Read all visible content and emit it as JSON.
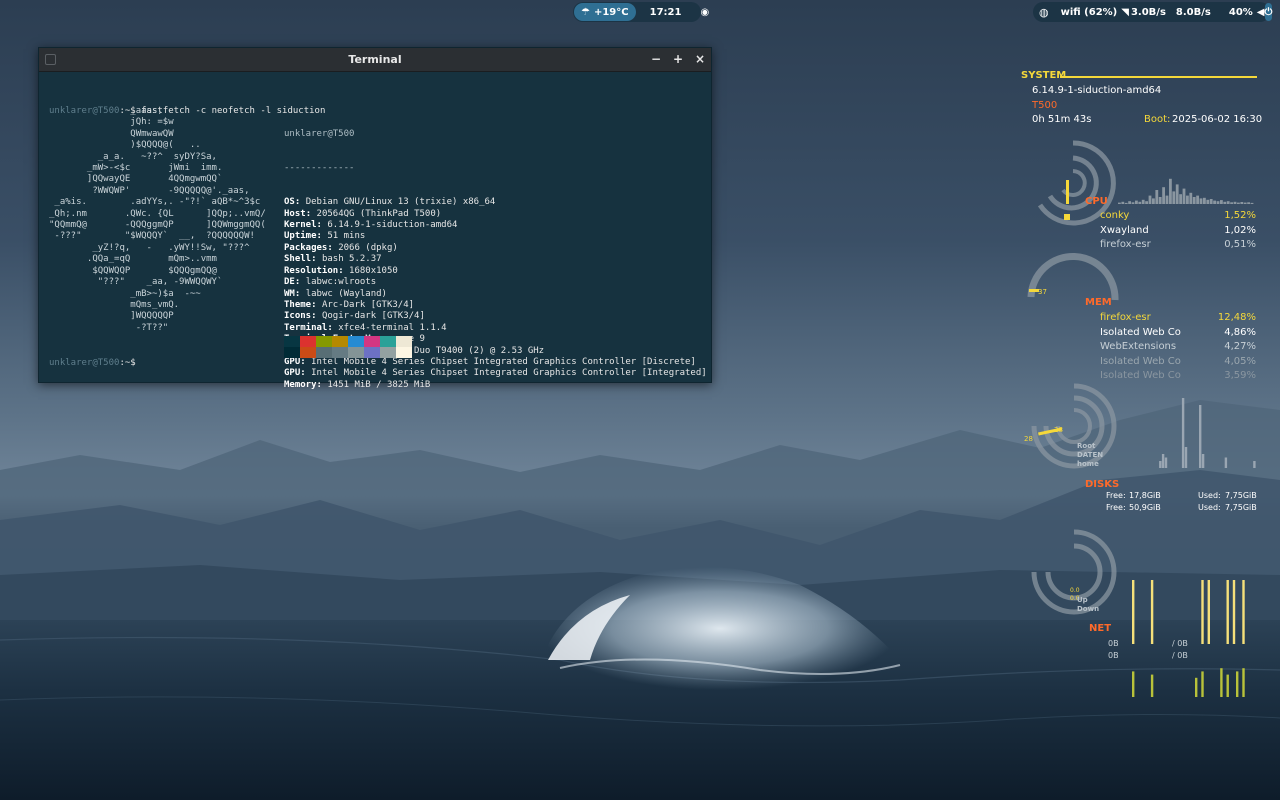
{
  "colors": {
    "accent_yellow": "#f5d83a",
    "accent_orange": "#ff6a2a",
    "term_bg": "#16323f",
    "pill_bg": "#1c3445",
    "pill_accent": "#2f6f93"
  },
  "topbar": {
    "center": {
      "weather_icon": "cloud-rain-icon",
      "temperature": "+19°C",
      "clock": "17:21",
      "eye_icon": "eye-icon"
    },
    "right": {
      "globe_icon": "globe-icon",
      "wifi": "wifi (62%)",
      "wifi_icon": "wifi-icon",
      "down_rate": "3.0B/s",
      "up_rate": "8.0B/s",
      "volume": "40%",
      "volume_icon": "speaker-icon",
      "power_icon": "power-icon"
    }
  },
  "terminal": {
    "title": "Terminal",
    "minimize": "−",
    "maximize": "+",
    "close": "×",
    "prompt_user": "unklarer@T500",
    "prompt_suffix": ":~$ ",
    "command": "fastfetch -c neofetch -l siduction",
    "ascii_art": "               _aass,\n               jQh: =$w\n               QWmwawQW\n               )$QQQQ@(   ..\n         _a_a.   ~??^  syDY?Sa,\n       _mW>-<$c       jWmi  imm.\n       ]QQwayQE       4QQmgwmQQ`\n        ?WWQWP'       -9QQQQQ@'._aas,\n _a%is.        .adYYs,. -\"?!` aQB*~^3$c\n_Qh;.nm       .QWc. {QL      ]QQp;..vmQ/\n\"QQmmQ@       -QQQggmQP      ]QQWmggmQQ(\n -???\"        \"$WQQQY`  __,  ?QQQQQQW!\n        _yZ!?q,   -   .yWY!!Sw, \"???^\n       .QQa_=qQ       mQm>..vmm\n        $QQWQQP       $QQQgmQQ@\n         \"???\"    _aa, -9WWQQWY`\n               _mB>~)$a  -~~\n               mQms_vmQ.\n               ]WQQQQQP\n                -?T??\"",
    "info_user": "unklarer@T500",
    "info_sep": "-------------",
    "info": [
      {
        "key": "OS",
        "value": "Debian GNU/Linux 13 (trixie) x86_64"
      },
      {
        "key": "Host",
        "value": "20564QG (ThinkPad T500)"
      },
      {
        "key": "Kernel",
        "value": "6.14.9-1-siduction-amd64"
      },
      {
        "key": "Uptime",
        "value": "51 mins"
      },
      {
        "key": "Packages",
        "value": "2066 (dpkg)"
      },
      {
        "key": "Shell",
        "value": "bash 5.2.37"
      },
      {
        "key": "Resolution",
        "value": "1680x1050"
      },
      {
        "key": "DE",
        "value": "labwc:wlroots"
      },
      {
        "key": "WM",
        "value": "labwc (Wayland)"
      },
      {
        "key": "Theme",
        "value": "Arc-Dark [GTK3/4]"
      },
      {
        "key": "Icons",
        "value": "Qogir-dark [GTK3/4]"
      },
      {
        "key": "Terminal",
        "value": "xfce4-terminal 1.1.4"
      },
      {
        "key": "Terminal Font",
        "value": "Monospace 9"
      },
      {
        "key": "CPU",
        "value": "Intel(R) Core(TM)2 Duo T9400 (2) @ 2.53 GHz"
      },
      {
        "key": "GPU",
        "value": "Intel Mobile 4 Series Chipset Integrated Graphics Controller [Discrete]"
      },
      {
        "key": "GPU",
        "value": "Intel Mobile 4 Series Chipset Integrated Graphics Controller [Integrated]"
      },
      {
        "key": "Memory",
        "value": "1451 MiB / 3825 MiB"
      }
    ],
    "palette_top": [
      "#073642",
      "#dc322f",
      "#859900",
      "#b58900",
      "#268bd2",
      "#d33682",
      "#2aa198",
      "#eee8d5"
    ],
    "palette_bottom": [
      "#002b36",
      "#cb4b16",
      "#586e75",
      "#657b83",
      "#839496",
      "#6c71c4",
      "#93a1a1",
      "#fdf6e3"
    ]
  },
  "conky": {
    "system_label": "SYSTEM",
    "kernel": "6.14.9-1-siduction-amd64",
    "hostname": "T500",
    "uptime": "0h 51m 43s",
    "boot_label": "Boot:",
    "boot_time": "2025-06-02 16:30",
    "cpu": {
      "label": "CPU",
      "processes": [
        {
          "name": "conky",
          "value": "1,52%"
        },
        {
          "name": "Xwayland",
          "value": "1,02%"
        },
        {
          "name": "firefox-esr",
          "value": "0,51%"
        }
      ],
      "graph": [
        0.05,
        0.08,
        0.04,
        0.1,
        0.06,
        0.12,
        0.08,
        0.15,
        0.1,
        0.3,
        0.2,
        0.5,
        0.25,
        0.6,
        0.3,
        0.9,
        0.45,
        0.7,
        0.35,
        0.55,
        0.3,
        0.4,
        0.25,
        0.3,
        0.2,
        0.22,
        0.15,
        0.18,
        0.12,
        0.1,
        0.14,
        0.08,
        0.1,
        0.06,
        0.08,
        0.05,
        0.07,
        0.05,
        0.06,
        0.04
      ]
    },
    "mem": {
      "label": "MEM",
      "value": "37",
      "processes": [
        {
          "name": "firefox-esr",
          "value": "12,48%"
        },
        {
          "name": "Isolated Web Co",
          "value": "4,86%"
        },
        {
          "name": "WebExtensions",
          "value": "4,27%"
        },
        {
          "name": "Isolated Web Co",
          "value": "4,05%"
        },
        {
          "name": "Isolated Web Co",
          "value": "3,59%"
        }
      ]
    },
    "disks": {
      "label": "DISKS",
      "ring_labels": [
        "Root",
        "DATEN",
        "home"
      ],
      "ring_values": [
        "28",
        "28"
      ],
      "rows": [
        {
          "free_label": "Free:",
          "free": "17,8GiB",
          "used_label": "Used:",
          "used": "7,75GiB"
        },
        {
          "free_label": "Free:",
          "free": "50,9GiB",
          "used_label": "Used:",
          "used": "7,75GiB"
        }
      ],
      "graph": [
        0,
        0,
        0,
        0,
        0,
        0,
        0.1,
        0.2,
        0.15,
        0,
        0,
        0,
        0,
        0,
        1.0,
        0.3,
        0,
        0,
        0,
        0,
        0.9,
        0.2,
        0,
        0,
        0,
        0,
        0,
        0,
        0,
        0.15,
        0,
        0,
        0,
        0,
        0,
        0,
        0,
        0,
        0,
        0.1
      ]
    },
    "net": {
      "label": "NET",
      "ring_labels": [
        "Up",
        "Down"
      ],
      "ring_value": "0.0",
      "rows": [
        {
          "a": "0B",
          "b": "/ 0B"
        },
        {
          "a": "0B",
          "b": "/ 0B"
        }
      ],
      "up_graph": [
        1,
        0,
        0,
        0,
        0,
        0,
        1,
        0,
        0,
        0,
        0,
        0,
        0,
        0,
        0,
        0,
        0,
        0,
        0,
        0,
        0,
        0,
        1,
        0,
        1,
        0,
        0,
        0,
        0,
        0,
        1,
        0,
        1,
        0,
        0,
        1,
        0,
        0,
        0,
        0
      ],
      "down_graph": [
        0.8,
        0,
        0,
        0,
        0,
        0,
        0.7,
        0,
        0,
        0,
        0,
        0,
        0,
        0,
        0,
        0,
        0,
        0,
        0,
        0,
        0.6,
        0,
        0.8,
        0,
        0,
        0,
        0,
        0,
        0.9,
        0,
        0.7,
        0,
        0,
        0.8,
        0,
        0.9,
        0,
        0,
        0,
        0
      ]
    }
  }
}
